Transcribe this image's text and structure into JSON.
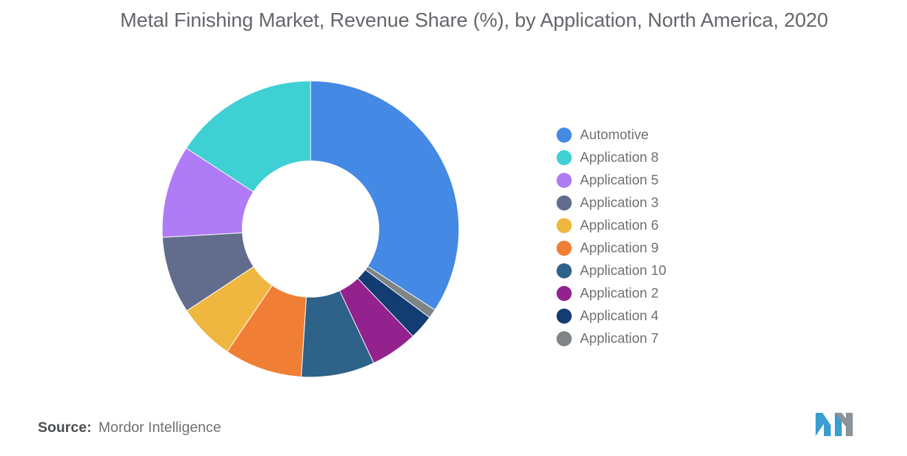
{
  "title": "Metal Finishing Market, Revenue Share (%), by Application, North America, 2020",
  "source": {
    "label": "Source:",
    "value": "Mordor Intelligence"
  },
  "logo": {
    "name": "mordor-intelligence-logo",
    "colors": [
      "#3c9dd0",
      "#8c9296"
    ]
  },
  "chart_data": {
    "type": "pie",
    "variant": "donut",
    "title": "Metal Finishing Market, Revenue Share (%), by Application, North America, 2020",
    "xlabel": "",
    "ylabel": "Revenue Share (%)",
    "unit": "%",
    "legend_position": "right",
    "grid": false,
    "inner_radius_ratio": 0.46,
    "start_angle_deg": 0,
    "direction": "clockwise",
    "labels": [
      "Automotive",
      "Application 8",
      "Application 5",
      "Application 3",
      "Application 6",
      "Application 9",
      "Application 10",
      "Application 2",
      "Application 4",
      "Application 7"
    ],
    "values": [
      34.2,
      15.8,
      10.1,
      8.4,
      6.2,
      8.5,
      8.0,
      5.1,
      2.7,
      1.0
    ],
    "colors": [
      "#4489e4",
      "#3fd0d4",
      "#b07cf5",
      "#626d8d",
      "#efb73f",
      "#f07f35",
      "#2e6288",
      "#93228f",
      "#123c72",
      "#7f8487"
    ],
    "slices": [
      {
        "label": "Automotive",
        "value": 34.2,
        "color": "#4489e4",
        "start_deg": 0.0,
        "end_deg": 123.1
      },
      {
        "label": "Application 7",
        "value": 1.0,
        "color": "#7f8487",
        "start_deg": 123.1,
        "end_deg": 126.7
      },
      {
        "label": "Application 4",
        "value": 2.7,
        "color": "#123c72",
        "start_deg": 126.7,
        "end_deg": 136.4
      },
      {
        "label": "Application 2",
        "value": 5.1,
        "color": "#93228f",
        "start_deg": 136.4,
        "end_deg": 154.8
      },
      {
        "label": "Application 10",
        "value": 8.0,
        "color": "#2e6288",
        "start_deg": 154.8,
        "end_deg": 183.6
      },
      {
        "label": "Application 9",
        "value": 8.5,
        "color": "#f07f35",
        "start_deg": 183.6,
        "end_deg": 214.2
      },
      {
        "label": "Application 6",
        "value": 6.2,
        "color": "#efb73f",
        "start_deg": 214.2,
        "end_deg": 236.5
      },
      {
        "label": "Application 3",
        "value": 8.4,
        "color": "#626d8d",
        "start_deg": 236.5,
        "end_deg": 266.8
      },
      {
        "label": "Application 5",
        "value": 10.1,
        "color": "#b07cf5",
        "start_deg": 266.8,
        "end_deg": 303.1
      },
      {
        "label": "Application 8",
        "value": 15.8,
        "color": "#3fd0d4",
        "start_deg": 303.1,
        "end_deg": 360.0
      }
    ]
  },
  "legend": {
    "items": [
      {
        "label": "Automotive",
        "color": "#4489e4"
      },
      {
        "label": "Application 8",
        "color": "#3fd0d4"
      },
      {
        "label": "Application 5",
        "color": "#b07cf5"
      },
      {
        "label": "Application 3",
        "color": "#626d8d"
      },
      {
        "label": "Application 6",
        "color": "#efb73f"
      },
      {
        "label": "Application 9",
        "color": "#f07f35"
      },
      {
        "label": "Application 10",
        "color": "#2e6288"
      },
      {
        "label": "Application 2",
        "color": "#93228f"
      },
      {
        "label": "Application 4",
        "color": "#123c72"
      },
      {
        "label": "Application 7",
        "color": "#7f8487"
      }
    ]
  }
}
